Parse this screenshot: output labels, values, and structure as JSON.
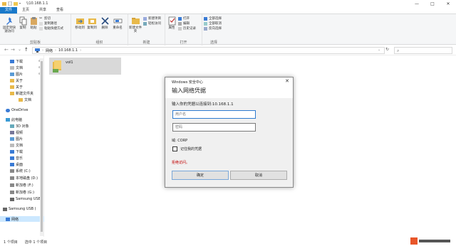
{
  "window": {
    "title": "\\\\10.168.1.1",
    "min": "—",
    "max": "□",
    "close": "✕"
  },
  "tabs": [
    {
      "label": "文件"
    },
    {
      "label": "主页"
    },
    {
      "label": "共享"
    },
    {
      "label": "查看"
    }
  ],
  "ribbon": {
    "clipboard": {
      "label": "剪贴板",
      "pin": "固定到快速访问",
      "copy": "复制",
      "paste": "粘贴",
      "cut": "剪切",
      "copy_path": "复制路径",
      "paste_shortcut": "粘贴快捷方式"
    },
    "organize": {
      "label": "组织",
      "move_to": "移动到",
      "copy_to": "复制到",
      "delete": "删除",
      "rename": "重命名"
    },
    "new": {
      "label": "新建",
      "new_folder": "新建文件夹",
      "new_item": "新建项目",
      "easy_access": "轻松访问"
    },
    "open": {
      "label": "打开",
      "properties": "属性",
      "open": "打开",
      "edit": "编辑",
      "history": "历史记录"
    },
    "select": {
      "label": "选择",
      "select_all": "全部选择",
      "select_none": "全部取消",
      "invert": "反向选择"
    }
  },
  "address": {
    "back": "←",
    "forward": "→",
    "recent": "⌄",
    "up": "↑",
    "crumbs": [
      {
        "label": "网络"
      },
      {
        "label": "10.168.1.1"
      }
    ],
    "refresh": "↻"
  },
  "sidebar": {
    "items": [
      {
        "label": "下载",
        "pin": "✲"
      },
      {
        "label": "文档",
        "pin": "✲"
      },
      {
        "label": "图片",
        "pin": "✲"
      },
      {
        "label": "关于",
        "pin": ""
      },
      {
        "label": "关于",
        "pin": ""
      },
      {
        "label": "新建文件夹",
        "pin": ""
      },
      {
        "label": "文档",
        "pin": ""
      },
      {
        "label": "OneDrive",
        "pin": ""
      },
      {
        "label": "此电脑",
        "pin": ""
      },
      {
        "label": "3D 对象",
        "pin": ""
      },
      {
        "label": "视频",
        "pin": ""
      },
      {
        "label": "图片",
        "pin": ""
      },
      {
        "label": "文档",
        "pin": ""
      },
      {
        "label": "下载",
        "pin": ""
      },
      {
        "label": "音乐",
        "pin": ""
      },
      {
        "label": "桌面",
        "pin": ""
      },
      {
        "label": "系统 (C:)",
        "pin": ""
      },
      {
        "label": "本地磁盘 (D:)",
        "pin": ""
      },
      {
        "label": "新加卷 (F:)",
        "pin": ""
      },
      {
        "label": "新加卷 (G:)",
        "pin": ""
      },
      {
        "label": "Samsung USB",
        "pin": ""
      },
      {
        "label": "Samsung USB (",
        "pin": ""
      },
      {
        "label": "网络",
        "pin": ""
      }
    ]
  },
  "content": {
    "folder": "vol1"
  },
  "status": {
    "count": "1 个项目",
    "selected": "选中 1 个项目"
  },
  "dialog": {
    "app": "Windows 安全中心",
    "title": "输入网络凭据",
    "subtitle": "输入你的凭据以连接到:10.168.1.1",
    "username_placeholder": "用户名",
    "password_placeholder": "密码",
    "domain": "域: CORP",
    "remember": "记住我的凭据",
    "error": "拒绝访问。",
    "ok": "确定",
    "cancel": "取消",
    "close": "✕"
  },
  "colors": {
    "accent": "#1979ca",
    "selection": "#cce8ff",
    "error": "#c00000",
    "folder": "#e8b94a"
  }
}
